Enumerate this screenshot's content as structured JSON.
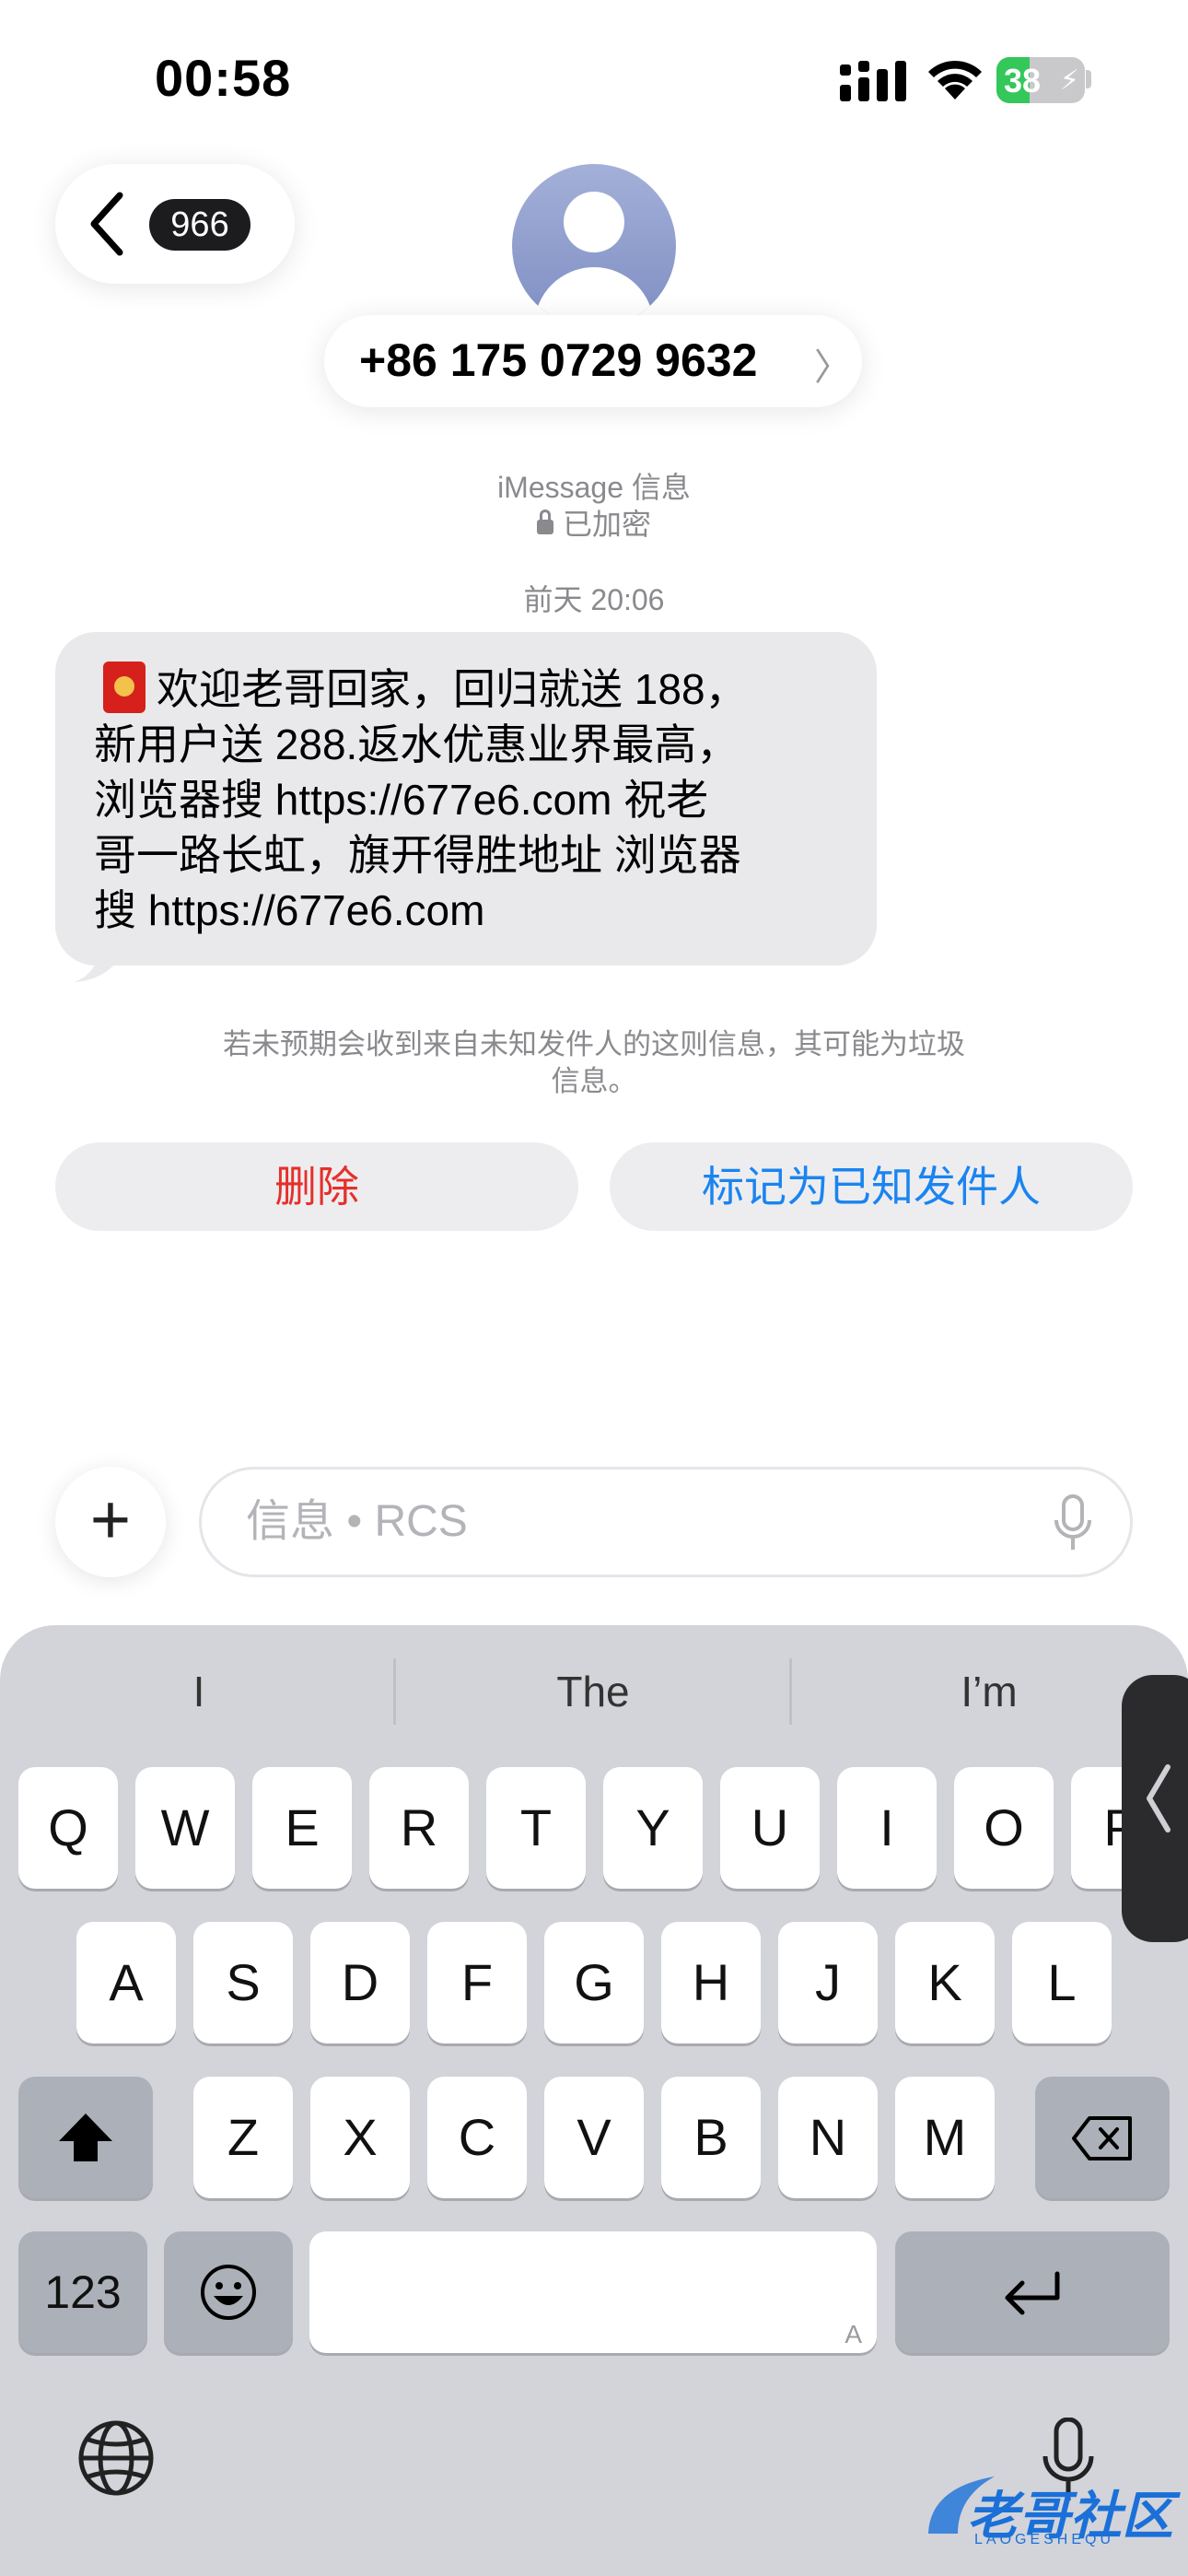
{
  "status_bar": {
    "time": "00:58",
    "battery": "38",
    "battery_level": 0.38
  },
  "header": {
    "back_badge": "966",
    "contact": "+86 175 0729 9632",
    "contact_chevron": "〉"
  },
  "meta": {
    "service": "iMessage 信息",
    "encryption": "已加密",
    "date": "前天 20:06"
  },
  "message": {
    "lines": [
      "欢迎老哥回家，回归就送 188，",
      "新用户送 288.返水优惠业界最高，",
      "浏览器搜  https://677e6.com 祝老",
      "哥一路长虹，旗开得胜地址 浏览器",
      "搜  https://677e6.com"
    ]
  },
  "junk_notice": {
    "line1": "若未预期会收到来自未知发件人的这则信息，其可能为垃圾",
    "line2": "信息。"
  },
  "actions": {
    "delete": "删除",
    "mark_known": "标记为已知发件人"
  },
  "compose": {
    "placeholder": "信息 • RCS"
  },
  "keyboard": {
    "suggestions": [
      "I",
      "The",
      "I’m"
    ],
    "row1": [
      "Q",
      "W",
      "E",
      "R",
      "T",
      "Y",
      "U",
      "I",
      "O",
      "P"
    ],
    "row2": [
      "A",
      "S",
      "D",
      "F",
      "G",
      "H",
      "J",
      "K",
      "L"
    ],
    "row3": [
      "Z",
      "X",
      "C",
      "V",
      "B",
      "N",
      "M"
    ],
    "numbers_key": "123",
    "space_hint": "A"
  },
  "watermark": {
    "text": "老哥社区",
    "sub": "LAOGESHEQU"
  },
  "colors": {
    "delete": "#e5302a",
    "link_blue": "#1a84f0",
    "battery_green": "#34c759"
  }
}
